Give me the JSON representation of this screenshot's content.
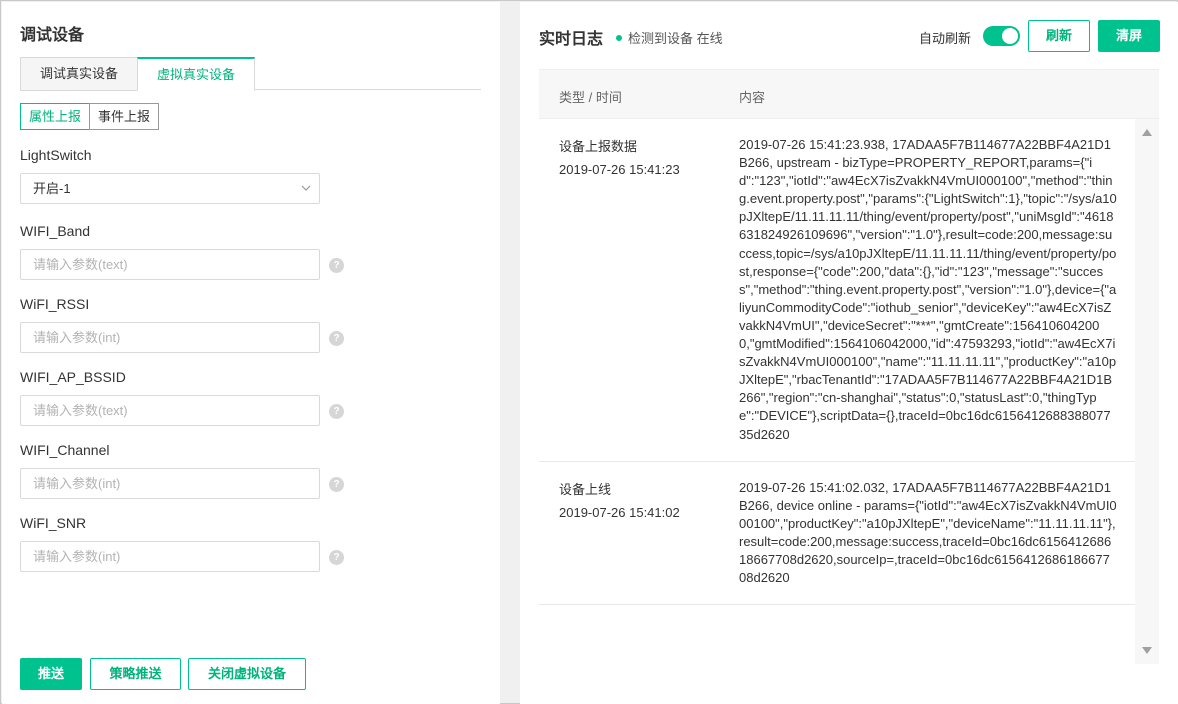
{
  "left_panel": {
    "title": "调试设备",
    "tabs": [
      {
        "label": "调试真实设备",
        "active": false
      },
      {
        "label": "虚拟真实设备",
        "active": true
      }
    ],
    "report_tabs": [
      {
        "label": "属性上报",
        "active": true
      },
      {
        "label": "事件上报",
        "active": false
      }
    ],
    "fields": [
      {
        "label": "LightSwitch",
        "type": "select",
        "value": "开启-1"
      },
      {
        "label": "WIFI_Band",
        "type": "input",
        "value": "",
        "placeholder": "请输入参数(text)"
      },
      {
        "label": "WiFI_RSSI",
        "type": "input",
        "value": "",
        "placeholder": "请输入参数(int)"
      },
      {
        "label": "WIFI_AP_BSSID",
        "type": "input",
        "value": "",
        "placeholder": "请输入参数(text)"
      },
      {
        "label": "WIFI_Channel",
        "type": "input",
        "value": "",
        "placeholder": "请输入参数(int)"
      },
      {
        "label": "WiFI_SNR",
        "type": "input",
        "value": "",
        "placeholder": "请输入参数(int)"
      }
    ],
    "help_icon": "question-circle-icon",
    "actions": {
      "push": "推送",
      "strategy_push": "策略推送",
      "close_virtual": "关闭虚拟设备"
    }
  },
  "right_panel": {
    "title": "实时日志",
    "status_text": "检测到设备 在线",
    "status_color": "#00c28f",
    "auto_refresh_label": "自动刷新",
    "auto_refresh_on": true,
    "refresh_label": "刷新",
    "clear_label": "清屏",
    "columns": [
      "类型 / 时间",
      "内容"
    ],
    "logs": [
      {
        "type": "设备上报数据",
        "time": "2019-07-26 15:41:23",
        "content": "2019-07-26 15:41:23.938, 17ADAA5F7B114677A22BBF4A21D1B266, upstream - bizType=PROPERTY_REPORT,params={\"id\":\"123\",\"iotId\":\"aw4EcX7isZvakkN4VmUI000100\",\"method\":\"thing.event.property.post\",\"params\":{\"LightSwitch\":1},\"topic\":\"/sys/a10pJXltepE/11.11.11.11/thing/event/property/post\",\"uniMsgId\":\"4618631824926109696\",\"version\":\"1.0\"},result=code:200,message:success,topic=/sys/a10pJXltepE/11.11.11.11/thing/event/property/post,response={\"code\":200,\"data\":{},\"id\":\"123\",\"message\":\"success\",\"method\":\"thing.event.property.post\",\"version\":\"1.0\"},device={\"aliyunCommodityCode\":\"iothub_senior\",\"deviceKey\":\"aw4EcX7isZvakkN4VmUI\",\"deviceSecret\":\"***\",\"gmtCreate\":1564106042000,\"gmtModified\":1564106042000,\"id\":47593293,\"iotId\":\"aw4EcX7isZvakkN4VmUI000100\",\"name\":\"11.11.11.11\",\"productKey\":\"a10pJXltepE\",\"rbacTenantId\":\"17ADAA5F7B114677A22BBF4A21D1B266\",\"region\":\"cn-shanghai\",\"status\":0,\"statusLast\":0,\"thingType\":\"DEVICE\"},scriptData={},traceId=0bc16dc615641268838807735d2620"
      },
      {
        "type": "设备上线",
        "time": "2019-07-26 15:41:02",
        "content": "2019-07-26 15:41:02.032, 17ADAA5F7B114677A22BBF4A21D1B266, device online - params={\"iotId\":\"aw4EcX7isZvakkN4VmUI000100\",\"productKey\":\"a10pJXltepE\",\"deviceName\":\"11.11.11.11\"},result=code:200,message:success,traceId=0bc16dc615641268618667708d2620,sourceIp=,traceId=0bc16dc615641268618667708d2620"
      }
    ]
  }
}
